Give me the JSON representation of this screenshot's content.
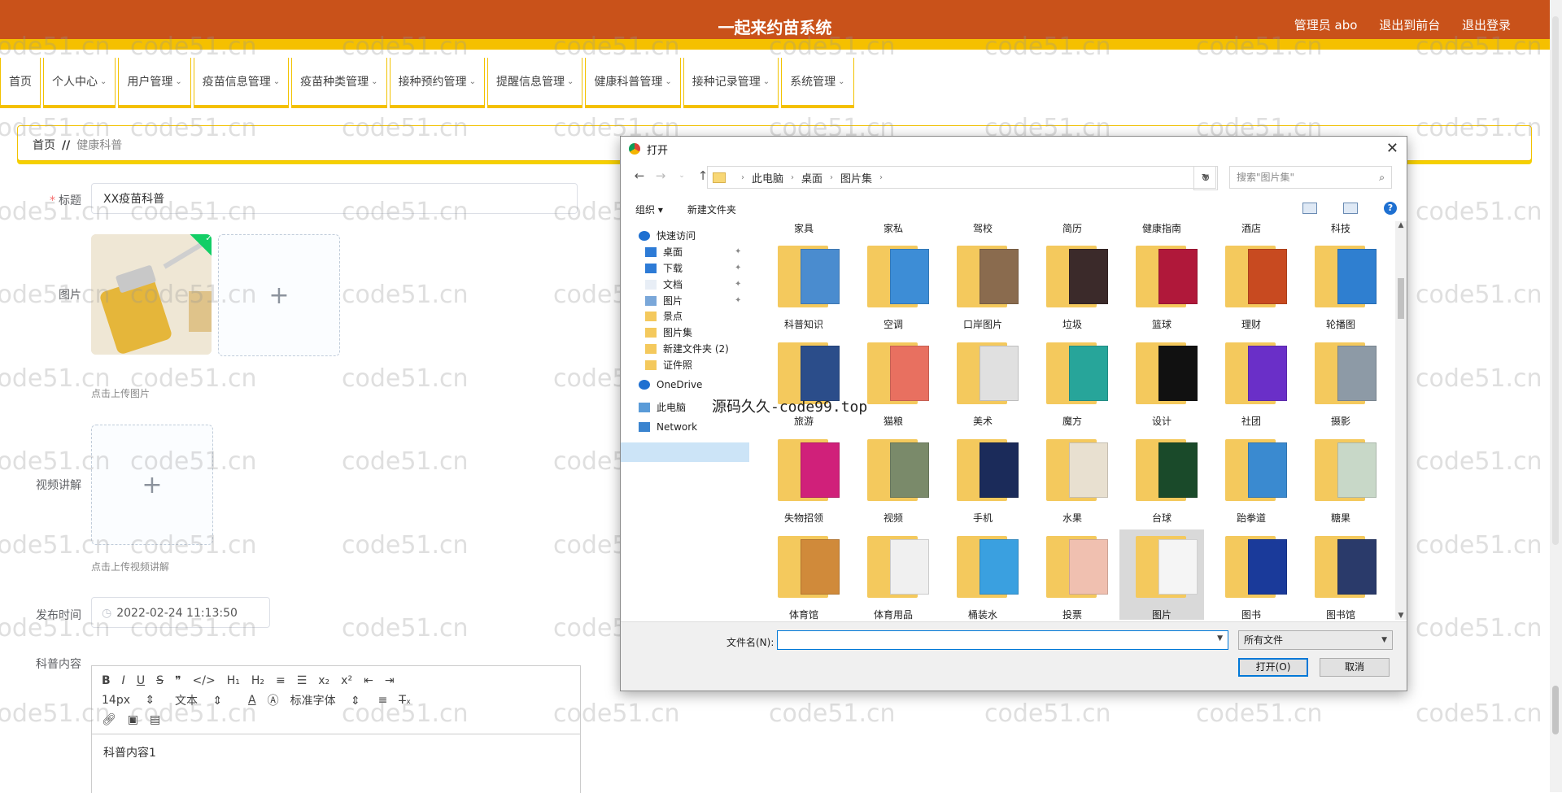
{
  "header": {
    "app_title": "一起来约苗系统",
    "admin_label": "管理员 abo",
    "back_to_front": "退出到前台",
    "logout": "退出登录"
  },
  "nav": [
    {
      "label": "首页",
      "has_menu": false
    },
    {
      "label": "个人中心",
      "has_menu": true
    },
    {
      "label": "用户管理",
      "has_menu": true
    },
    {
      "label": "疫苗信息管理",
      "has_menu": true
    },
    {
      "label": "疫苗种类管理",
      "has_menu": true
    },
    {
      "label": "接种预约管理",
      "has_menu": true
    },
    {
      "label": "提醒信息管理",
      "has_menu": true
    },
    {
      "label": "健康科普管理",
      "has_menu": true
    },
    {
      "label": "接种记录管理",
      "has_menu": true
    },
    {
      "label": "系统管理",
      "has_menu": true
    }
  ],
  "breadcrumb": {
    "home": "首页",
    "separator": "//",
    "current": "健康科普"
  },
  "form": {
    "title_label": "标题",
    "title_value": "XX疫苗科普",
    "image_label": "图片",
    "image_hint": "点击上传图片",
    "video_label": "视频讲解",
    "video_hint": "点击上传视频讲解",
    "date_label": "发布时间",
    "date_value": "2022-02-24 11:13:50",
    "content_label": "科普内容",
    "editor": {
      "font_size": "14px",
      "paragraph": "文本",
      "font_family": "标准字体",
      "body": "科普内容1"
    }
  },
  "watermark": {
    "text": "code51.cn",
    "overlay": "源码久久-code99.top"
  },
  "dialog": {
    "title": "打开",
    "path": [
      "此电脑",
      "桌面",
      "图片集"
    ],
    "search_placeholder": "搜索\"图片集\"",
    "organize": "组织 ▾",
    "new_folder": "新建文件夹",
    "nav_tree": [
      {
        "label": "快速访问",
        "icon": "star-icon",
        "pinned": false
      },
      {
        "label": "桌面",
        "icon": "desktop-icon",
        "pinned": true
      },
      {
        "label": "下载",
        "icon": "download-icon",
        "pinned": true
      },
      {
        "label": "文档",
        "icon": "document-icon",
        "pinned": true
      },
      {
        "label": "图片",
        "icon": "pictures-icon",
        "pinned": true
      },
      {
        "label": "景点",
        "icon": "folder-icon",
        "pinned": false
      },
      {
        "label": "图片集",
        "icon": "folder-icon",
        "pinned": false
      },
      {
        "label": "新建文件夹 (2)",
        "icon": "folder-icon",
        "pinned": false
      },
      {
        "label": "证件照",
        "icon": "folder-icon",
        "pinned": false
      },
      {
        "label": "OneDrive",
        "icon": "cloud-icon",
        "pinned": false
      },
      {
        "label": "此电脑",
        "icon": "computer-icon",
        "pinned": false
      },
      {
        "label": "Network",
        "icon": "network-icon",
        "pinned": false
      }
    ],
    "selected_tree_item": "此电脑",
    "top_row_labels": [
      "家具",
      "家私",
      "驾校",
      "简历",
      "健康指南",
      "酒店",
      "科技"
    ],
    "folders": [
      {
        "name": "科普知识",
        "accent": "#4a8ccf"
      },
      {
        "name": "空调",
        "accent": "#3d8dd6"
      },
      {
        "name": "口岸图片",
        "accent": "#8a6b4e"
      },
      {
        "name": "垃圾",
        "accent": "#3b2a2a"
      },
      {
        "name": "篮球",
        "accent": "#b0183a"
      },
      {
        "name": "理财",
        "accent": "#c84a20"
      },
      {
        "name": "轮播图",
        "accent": "#2f7fd0"
      },
      {
        "name": "旅游",
        "accent": "#2b4d8a"
      },
      {
        "name": "猫粮",
        "accent": "#e87060"
      },
      {
        "name": "美术",
        "accent": "#e0e0e0"
      },
      {
        "name": "魔方",
        "accent": "#27a59a"
      },
      {
        "name": "设计",
        "accent": "#111111"
      },
      {
        "name": "社团",
        "accent": "#6a2fc8"
      },
      {
        "name": "摄影",
        "accent": "#8d9aa6"
      },
      {
        "name": "失物招领",
        "accent": "#d0207a"
      },
      {
        "name": "视频",
        "accent": "#7a8a6a"
      },
      {
        "name": "手机",
        "accent": "#1b2b5a"
      },
      {
        "name": "水果",
        "accent": "#e8e0d0"
      },
      {
        "name": "台球",
        "accent": "#1a4a2a"
      },
      {
        "name": "跆拳道",
        "accent": "#3a8ad0"
      },
      {
        "name": "糖果",
        "accent": "#c8d8c8"
      },
      {
        "name": "体育馆",
        "accent": "#d08a3a"
      },
      {
        "name": "体育用品",
        "accent": "#f0f0f0"
      },
      {
        "name": "桶装水",
        "accent": "#3aa0e0"
      },
      {
        "name": "投票",
        "accent": "#f0c0b0"
      },
      {
        "name": "图片",
        "accent": "#f5f5f5",
        "selected": true
      },
      {
        "name": "图书",
        "accent": "#1a3a9a"
      },
      {
        "name": "图书馆",
        "accent": "#2a3a6a"
      }
    ],
    "filename_label": "文件名(N):",
    "filename_value": "",
    "filetype": "所有文件",
    "open_button": "打开(O)",
    "cancel_button": "取消"
  }
}
